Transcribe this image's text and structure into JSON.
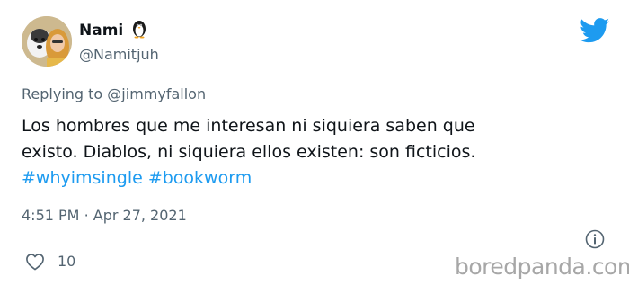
{
  "user": {
    "name": "Nami",
    "handle": "@Namitjuh"
  },
  "reply": {
    "prefix": "Replying to",
    "mention": "@jimmyfallon"
  },
  "tweet": {
    "line1": "Los hombres que me interesan ni siquiera saben que",
    "line2": "existo. Diablos, ni siquiera ellos existen: son ficticios.",
    "hashtag1": "#whyimsingle",
    "hashtag2": "#bookworm"
  },
  "meta": {
    "time": "4:51 PM",
    "separator": "·",
    "date": "Apr 27, 2021"
  },
  "engagement": {
    "likes": "10"
  },
  "watermark": "boredpanda.com",
  "colors": {
    "accent": "#1d9bf0",
    "secondary_text": "#536471",
    "primary_text": "#0f1419"
  },
  "icons": {
    "verified_badge": "penguin-emoji",
    "platform": "twitter-bird-icon",
    "info": "info-icon",
    "like": "heart-icon"
  }
}
